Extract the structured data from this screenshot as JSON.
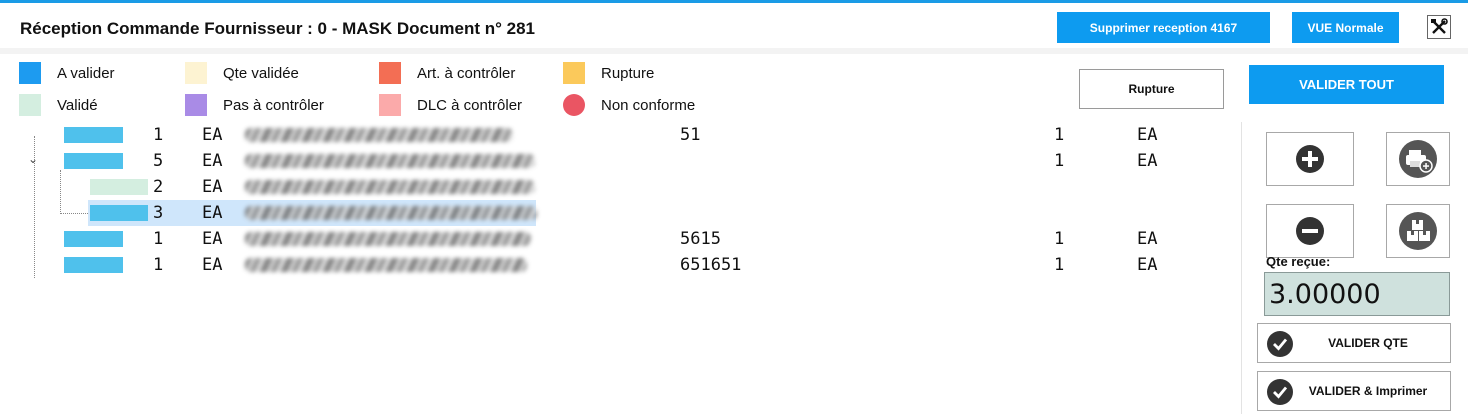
{
  "header": {
    "title": "Réception Commande Fournisseur : 0 - MASK Document n° 281",
    "delete_button": "Supprimer reception 4167",
    "view_button": "VUE Normale",
    "tools_icon": "tools-icon"
  },
  "legend": [
    {
      "label": "A valider",
      "color": "#1d9bf0",
      "shape": "square"
    },
    {
      "label": "Validé",
      "color": "#d4eee0",
      "shape": "square"
    },
    {
      "label": "Qte validée",
      "color": "#fdf3d2",
      "shape": "square"
    },
    {
      "label": "Pas à contrôler",
      "color": "#a98be6",
      "shape": "square"
    },
    {
      "label": "Art. à contrôler",
      "color": "#f36e54",
      "shape": "square"
    },
    {
      "label": "DLC à contrôler",
      "color": "#fbaaaa",
      "shape": "square"
    },
    {
      "label": "Rupture",
      "color": "#fbc95b",
      "shape": "square"
    },
    {
      "label": "Non conforme",
      "color": "#ea5563",
      "shape": "circle"
    }
  ],
  "buttons": {
    "rupture": "Rupture",
    "valider_tout": "VALIDER TOUT"
  },
  "rows": [
    {
      "qty": "1",
      "unit": "EA",
      "ref": "51",
      "recv_qty": "1",
      "recv_unit": "EA",
      "status_color": "#4fc1ec"
    },
    {
      "qty": "5",
      "unit": "EA",
      "ref": "",
      "recv_qty": "1",
      "recv_unit": "EA",
      "status_color": "#4fc1ec",
      "expanded": true
    },
    {
      "qty": "2",
      "unit": "EA",
      "ref": "",
      "recv_qty": "",
      "recv_unit": "",
      "status_color": "#d4eee0",
      "child": true
    },
    {
      "qty": "3",
      "unit": "EA",
      "ref": "",
      "recv_qty": "",
      "recv_unit": "",
      "status_color": "#4fc1ec",
      "child": true,
      "selected": true
    },
    {
      "qty": "1",
      "unit": "EA",
      "ref": "5615",
      "recv_qty": "1",
      "recv_unit": "EA",
      "status_color": "#4fc1ec"
    },
    {
      "qty": "1",
      "unit": "EA",
      "ref": "651651",
      "recv_qty": "1",
      "recv_unit": "EA",
      "status_color": "#4fc1ec"
    }
  ],
  "panel": {
    "qty_label": "Qte reçue:",
    "qty_value": "3.00000",
    "valider_qte": "VALIDER QTE",
    "valider_imprimer": "VALIDER & Imprimer"
  }
}
